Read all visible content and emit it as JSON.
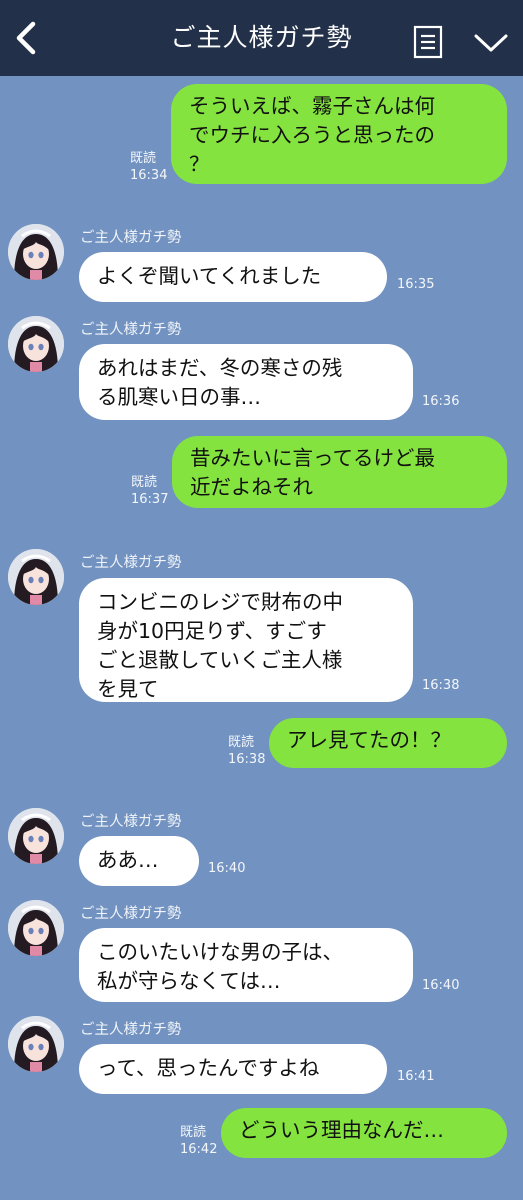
{
  "header": {
    "title": "ご主人様ガチ勢",
    "back_icon": "chevron-left-icon",
    "menu_icon": "menu-list-icon",
    "expand_icon": "chevron-down-icon"
  },
  "colors": {
    "header_bg": "#223049",
    "chat_bg": "#7293c1",
    "my_bubble": "#84e33e",
    "their_bubble": "#ffffff"
  },
  "messages": [
    {
      "from": "me",
      "text": "そういえば、霧子さんは何\nでウチに入ろうと思ったの\n？",
      "read": "既読",
      "time": "16:34"
    },
    {
      "from": "them",
      "sender": "ご主人様ガチ勢",
      "text": "よくぞ聞いてくれました",
      "time": "16:35"
    },
    {
      "from": "them",
      "sender": "ご主人様ガチ勢",
      "text": "あれはまだ、冬の寒さの残\nる肌寒い日の事…",
      "time": "16:36"
    },
    {
      "from": "me",
      "text": "昔みたいに言ってるけど最\n近だよねそれ",
      "read": "既読",
      "time": "16:37"
    },
    {
      "from": "them",
      "sender": "ご主人様ガチ勢",
      "text": "コンビニのレジで財布の中\n身が10円足りず、すごす\nごと退散していくご主人様\nを見て",
      "time": "16:38"
    },
    {
      "from": "me",
      "text": "アレ見てたの！？",
      "read": "既読",
      "time": "16:38"
    },
    {
      "from": "them",
      "sender": "ご主人様ガチ勢",
      "text": "ああ…",
      "time": "16:40"
    },
    {
      "from": "them",
      "sender": "ご主人様ガチ勢",
      "text": "このいたいけな男の子は、\n私が守らなくては…",
      "time": "16:40"
    },
    {
      "from": "them",
      "sender": "ご主人様ガチ勢",
      "text": "って、思ったんですよね",
      "time": "16:41"
    },
    {
      "from": "me",
      "text": "どういう理由なんだ…",
      "read": "既読",
      "time": "16:42"
    }
  ]
}
